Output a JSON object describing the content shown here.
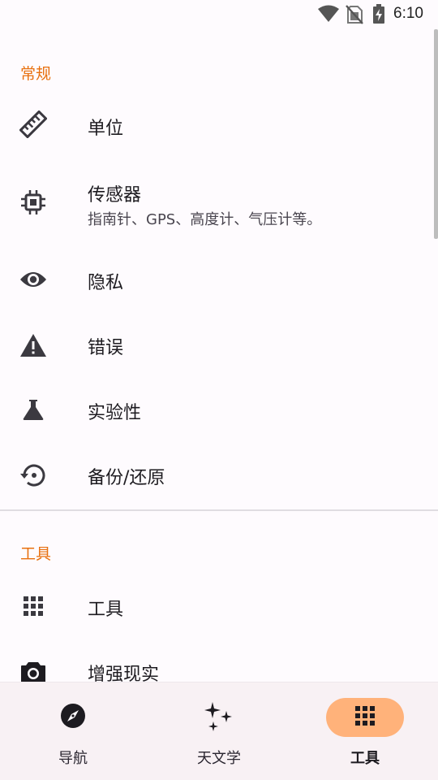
{
  "status_bar": {
    "time": "6:10",
    "icons": [
      "wifi-icon",
      "no-sim-icon",
      "battery-charging-icon"
    ]
  },
  "sections": {
    "general": {
      "header": "常规",
      "items": [
        {
          "title": "单位",
          "icon": "ruler-icon"
        },
        {
          "title": "传感器",
          "summary": "指南针、GPS、高度计、气压计等。",
          "icon": "chip-icon"
        },
        {
          "title": "隐私",
          "icon": "eye-icon"
        },
        {
          "title": "错误",
          "icon": "warning-icon"
        },
        {
          "title": "实验性",
          "icon": "flask-icon"
        },
        {
          "title": "备份/还原",
          "icon": "restore-icon"
        }
      ]
    },
    "tools": {
      "header": "工具",
      "items": [
        {
          "title": "工具",
          "icon": "grid-icon"
        },
        {
          "title": "增强现实",
          "icon": "camera-icon"
        }
      ]
    }
  },
  "bottom_nav": {
    "items": [
      {
        "label": "导航",
        "icon": "compass-icon",
        "active": false
      },
      {
        "label": "天文学",
        "icon": "sparkle-icon",
        "active": false
      },
      {
        "label": "工具",
        "icon": "grid-icon",
        "active": true
      }
    ]
  },
  "colors": {
    "accent": "#e8700f",
    "active_pill": "#ffb27a",
    "icon": "#3b3940",
    "background": "#fefbfe"
  }
}
